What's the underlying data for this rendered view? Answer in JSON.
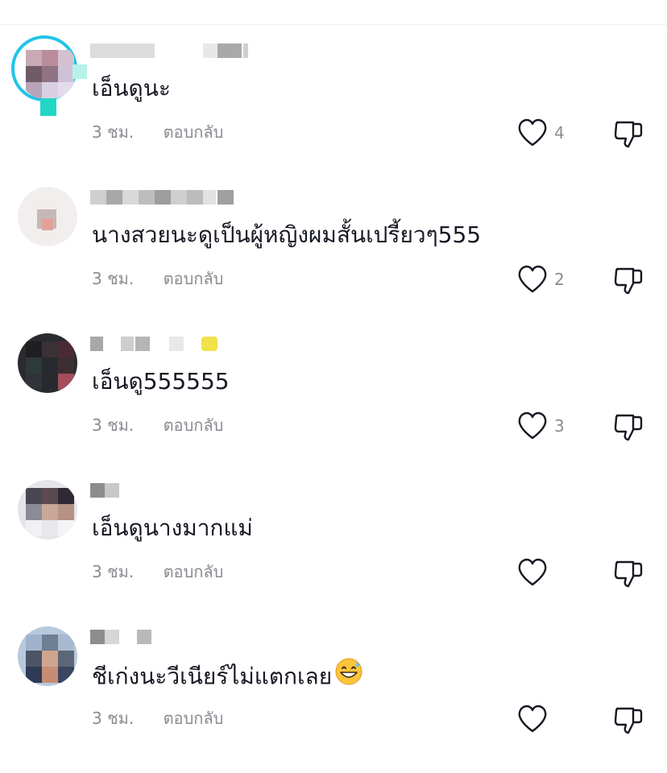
{
  "comments": [
    {
      "text": "เอ็นดูนะ",
      "time": "3 ชม.",
      "reply": "ตอบกลับ",
      "likes": "4"
    },
    {
      "text": "นางสวยนะดูเป็นผู้หญิงผมสั้นเปรี้ยวๆ555",
      "time": "3 ชม.",
      "reply": "ตอบกลับ",
      "likes": "2"
    },
    {
      "text": "เอ็นดู555555",
      "time": "3 ชม.",
      "reply": "ตอบกลับ",
      "likes": "3"
    },
    {
      "text": "เอ็นดูนางมากแม่",
      "time": "3 ชม.",
      "reply": "ตอบกลับ",
      "likes": ""
    },
    {
      "text": "ชีเก่งนะวีเนียร์ไม่แตกเลย",
      "time": "3 ชม.",
      "reply": "ตอบกลับ",
      "likes": "",
      "emoji": "grinning-sweat-emoji"
    }
  ],
  "colors": {
    "text": "#161823",
    "muted": "#8a8b91",
    "ring": "#20c4e6"
  }
}
